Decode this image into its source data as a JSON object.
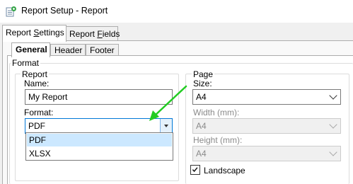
{
  "window": {
    "title": "Report Setup - Report"
  },
  "outer_tabs": [
    {
      "label": "Report Settings"
    },
    {
      "label": "Report Fields"
    }
  ],
  "inner_tabs": [
    {
      "label": "General"
    },
    {
      "label": "Header"
    },
    {
      "label": "Footer"
    }
  ],
  "format_group": {
    "legend": "Format"
  },
  "report_group": {
    "legend": "Report",
    "name_label": "Name:",
    "name_value": "My Report",
    "format_label": "Format:",
    "format_value": "PDF",
    "format_options": [
      "PDF",
      "XLSX"
    ]
  },
  "page_group": {
    "legend": "Page",
    "size_label": "Size:",
    "size_value": "A4",
    "width_label": "Width (mm):",
    "width_value": "A4",
    "height_label": "Height (mm):",
    "height_value": "A4",
    "landscape_label": "Landscape",
    "landscape_checked": true
  },
  "colors": {
    "arrow": "#22cc22",
    "selected_option": "#cce8ff"
  }
}
